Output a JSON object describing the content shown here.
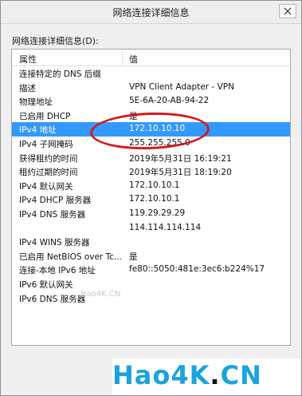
{
  "window": {
    "title": "网络连接详细信息",
    "close_icon": "close-icon"
  },
  "content_label": "网络连接详细信息(D):",
  "table": {
    "headers": [
      "属性",
      "值"
    ],
    "rows": [
      {
        "prop": "连接特定的 DNS 后缀",
        "value": ""
      },
      {
        "prop": "描述",
        "value": "VPN Client Adapter - VPN"
      },
      {
        "prop": "物理地址",
        "value": "5E-6A-20-AB-94-22"
      },
      {
        "prop": "已启用 DHCP",
        "value": "是"
      },
      {
        "prop": "IPv4 地址",
        "value": "172.10.10.10",
        "selected": true
      },
      {
        "prop": "IPv4 子网掩码",
        "value": "255.255.255.0"
      },
      {
        "prop": "获得租约的时间",
        "value": "2019年5月31日 16:19:21"
      },
      {
        "prop": "租约过期的时间",
        "value": "2019年5月31日 18:19:20"
      },
      {
        "prop": "IPv4 默认网关",
        "value": "172.10.10.1"
      },
      {
        "prop": "IPv4 DHCP 服务器",
        "value": "172.10.10.1"
      },
      {
        "prop": "IPv4 DNS 服务器",
        "value": "119.29.29.29"
      },
      {
        "prop": "",
        "value": "114.114.114.114"
      },
      {
        "prop": "IPv4 WINS 服务器",
        "value": ""
      },
      {
        "prop": "已启用 NetBIOS over Tc...",
        "value": "是"
      },
      {
        "prop": "连接-本地 IPv6 地址",
        "value": "fe80::5050:481e:3ec6:b224%17"
      },
      {
        "prop": "IPv6 默认网关",
        "value": ""
      },
      {
        "prop": "IPv6 DNS 服务器",
        "value": ""
      }
    ]
  },
  "annotation": {
    "color": "#d7191c"
  },
  "watermark": "Hao4K.CN",
  "logo": {
    "main": "Hao4K",
    "dot": ".",
    "suffix": "CN",
    "brand_color": "#1aa3e0"
  }
}
